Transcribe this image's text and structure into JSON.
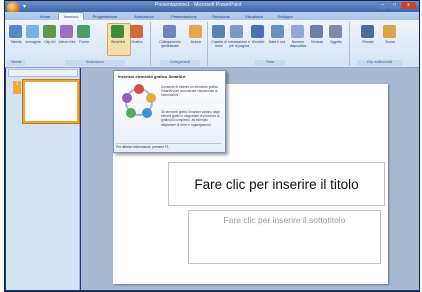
{
  "window": {
    "title": "Presentazione1 - Microsoft PowerPoint",
    "controls": {
      "minimize": "–",
      "maximize": "□",
      "close": "x"
    }
  },
  "tabs": [
    "Home",
    "Inserisci",
    "Progettazione",
    "Animazioni",
    "Presentazione",
    "Revisione",
    "Visualizza",
    "Sviluppo"
  ],
  "ribbon": {
    "groups": [
      "Tabelle",
      "Illustrazioni",
      "Collegamenti",
      "Testo",
      "Clip multimediali"
    ],
    "buttons": [
      "Tabella",
      "Immagine",
      "Clip Art",
      "Album foto",
      "Forme",
      "SmartArt",
      "Grafico",
      "Collegamento ipertestuale",
      "Azione",
      "Casella di testo",
      "Intestazione e piè di pagina",
      "WordArt",
      "Data e ora",
      "Numero diapositiva",
      "Simbolo",
      "Oggetto",
      "Filmato",
      "Suono"
    ],
    "highlighted": "SmartArt"
  },
  "tooltip": {
    "title": "Inserisci elemento grafico SmartArt",
    "text1": "Consente di inserire un elemento grafico SmartArt per comunicare visivamente le informazioni.",
    "text2": "Gli elementi grafici SmartArt variano dagli elenchi grafici e diagrammi di processo ai grafici più complessi, ad esempio diagrammi di Venn e organigrammi.",
    "footer": "Per ulteriori informazioni, premere F1."
  },
  "slide_panel": {
    "slide_number": "1"
  },
  "slide": {
    "title_placeholder": "Fare clic per inserire il titolo",
    "subtitle_placeholder": "Fare clic per inserire il sottotitolo"
  },
  "colors": {
    "ribbon_bg": "#dbe6f5",
    "accent": "#f1a33c",
    "title_bar": "#3d66a8"
  }
}
